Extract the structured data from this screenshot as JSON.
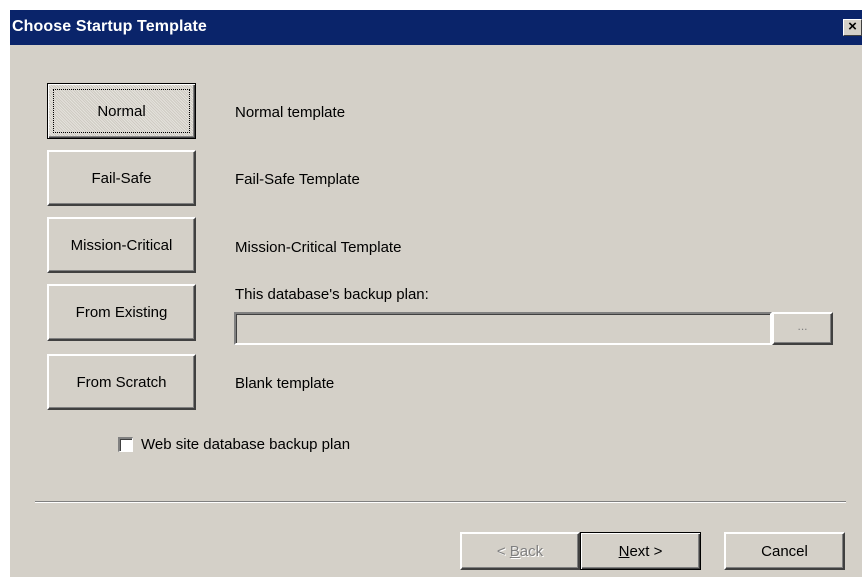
{
  "window": {
    "title": "Choose Startup Template",
    "close_glyph": "×"
  },
  "templates": [
    {
      "button": "Normal",
      "description": "Normal template"
    },
    {
      "button": "Fail-Safe",
      "description": "Fail-Safe Template"
    },
    {
      "button": "Mission-Critical",
      "description": "Mission-Critical Template"
    },
    {
      "button": "From Existing",
      "description": "This database's backup plan:"
    },
    {
      "button": "From Scratch",
      "description": "Blank template"
    }
  ],
  "existing_plan": {
    "path_value": "",
    "browse_label": "..."
  },
  "web_site_checkbox": {
    "label": "Web site database backup plan",
    "checked": false
  },
  "footer": {
    "back_prefix": "< ",
    "back_mnemonic": "B",
    "back_rest": "ack",
    "next_mnemonic": "N",
    "next_rest": "ext >",
    "cancel_label": "Cancel"
  },
  "colors": {
    "titlebar": "#0a246a",
    "dialog_face": "#d4d0c8"
  }
}
